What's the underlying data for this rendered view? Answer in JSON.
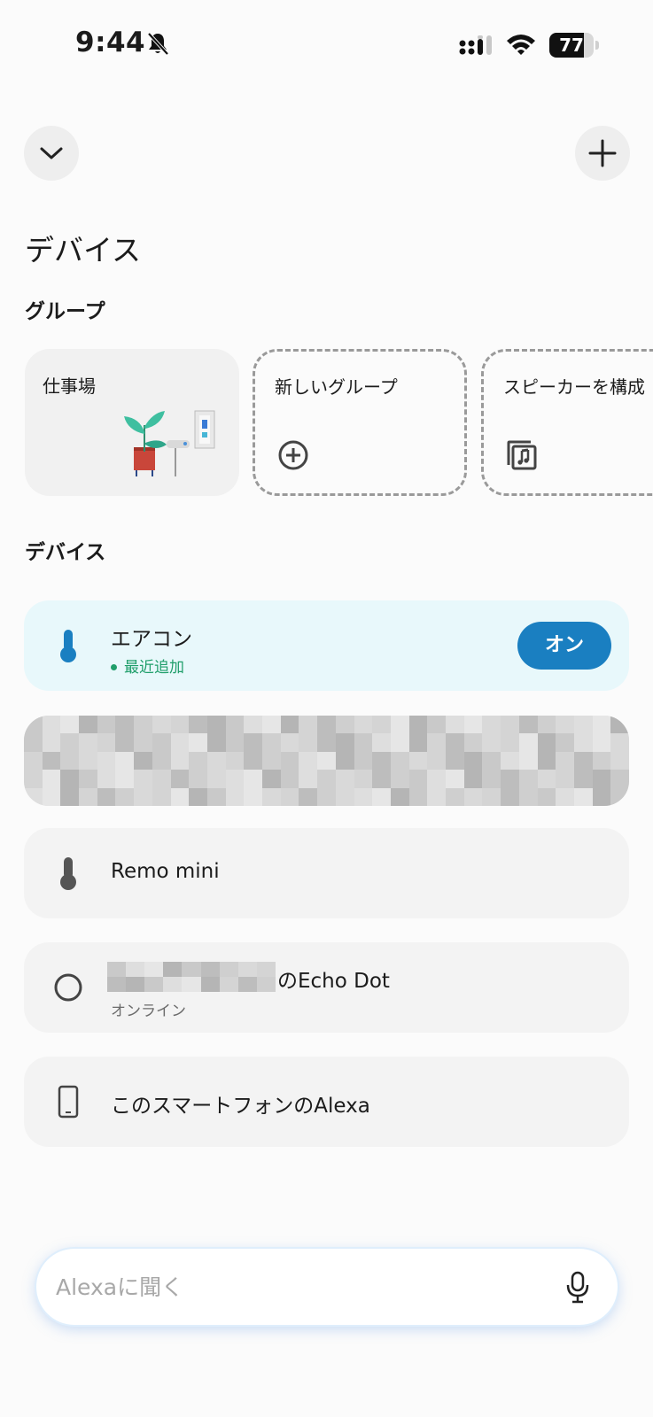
{
  "status_bar": {
    "time": "9:44",
    "battery_level": "77",
    "battery_fraction": 0.77
  },
  "header": {
    "collapse_icon": "chevron-down-icon",
    "add_icon": "plus-icon"
  },
  "page_title": "デバイス",
  "groups": {
    "title": "グループ",
    "items": [
      {
        "label": "仕事場",
        "icon": "workplace-illustration"
      },
      {
        "label": "新しいグループ",
        "icon": "plus-circle-icon"
      },
      {
        "label": "スピーカーを構成",
        "icon": "speaker-group-icon"
      }
    ]
  },
  "devices": {
    "title": "デバイス",
    "items": [
      {
        "name": "エアコン",
        "status": "最近追加",
        "action": "オン",
        "icon": "thermometer-icon"
      },
      {
        "name": "",
        "status": "",
        "icon": ""
      },
      {
        "name": "Remo mini",
        "status": "",
        "icon": "thermometer-icon"
      },
      {
        "name": "のEcho Dot",
        "status": "オンライン",
        "icon": "circle-icon"
      },
      {
        "name": "このスマートフォンのAlexa",
        "status": "",
        "icon": "smartphone-icon"
      }
    ]
  },
  "ask_bar": {
    "placeholder": "Alexaに聞く",
    "mic_icon": "microphone-icon"
  },
  "colors": {
    "accent": "#1a7fc1",
    "status_green": "#1f9e6a",
    "active_card_bg": "#e8f8fb"
  }
}
